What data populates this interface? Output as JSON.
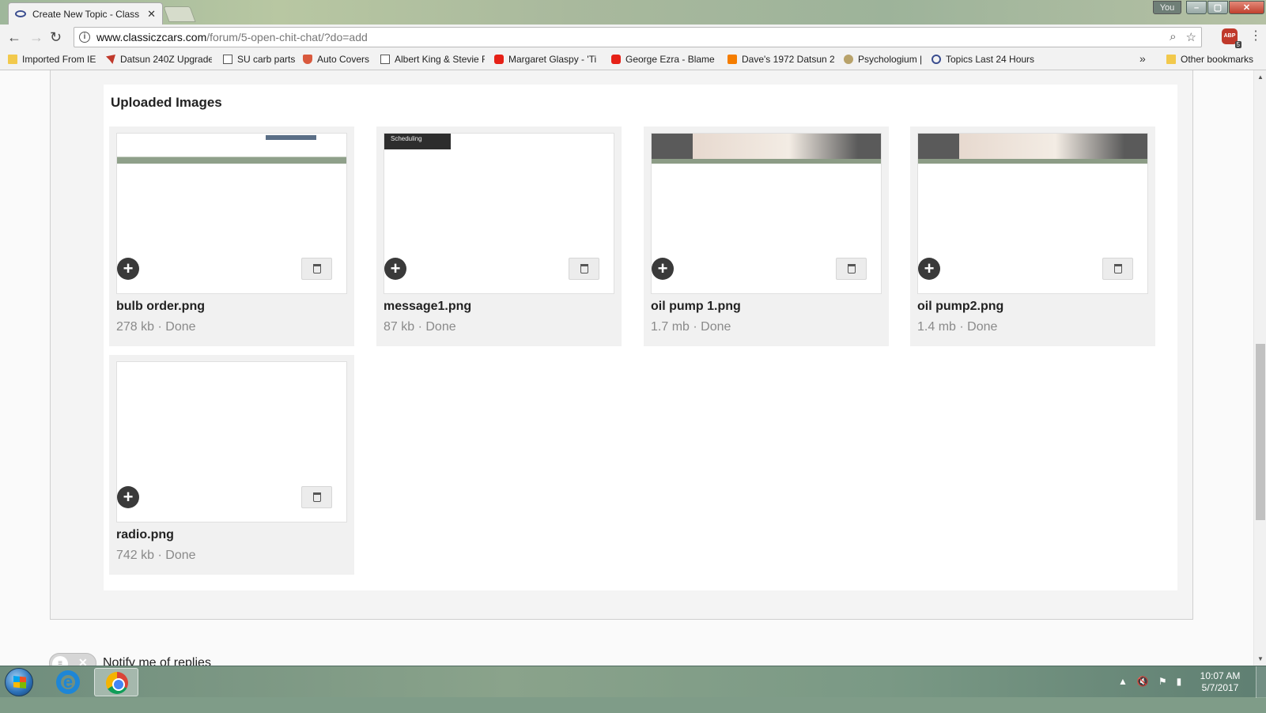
{
  "browser": {
    "tab_title": "Create New Topic - Class",
    "tab_close": "✕",
    "profile": "You",
    "url_host": "www.classiczcars.com",
    "url_path": "/forum/5-open-chit-chat/?do=add",
    "extension_badge": "5",
    "bookmarks": [
      {
        "label": "Imported From IE"
      },
      {
        "label": "Datsun 240Z Upgrade"
      },
      {
        "label": "SU carb parts"
      },
      {
        "label": "Auto Covers"
      },
      {
        "label": "Albert King & Stevie F"
      },
      {
        "label": "Margaret Glaspy - 'Ti"
      },
      {
        "label": "George Ezra - Blame I"
      },
      {
        "label": "Dave's 1972 Datsun 2"
      },
      {
        "label": "Psychologium |"
      },
      {
        "label": "Topics Last 24 Hours"
      }
    ],
    "bookmarks_overflow": "»",
    "other_bookmarks": "Other bookmarks"
  },
  "uploads": {
    "heading": "Uploaded Images",
    "files": [
      {
        "name": "bulb order.png",
        "meta": "278 kb · Done"
      },
      {
        "name": "message1.png",
        "meta": "87 kb · Done",
        "thumb_text": "Scheduling"
      },
      {
        "name": "oil pump 1.png",
        "meta": "1.7 mb · Done"
      },
      {
        "name": "oil pump2.png",
        "meta": "1.4 mb · Done"
      },
      {
        "name": "radio.png",
        "meta": "742 kb · Done"
      }
    ]
  },
  "notify": {
    "label": "Notify me of replies"
  },
  "taskbar": {
    "time": "10:07 AM",
    "date": "5/7/2017"
  }
}
